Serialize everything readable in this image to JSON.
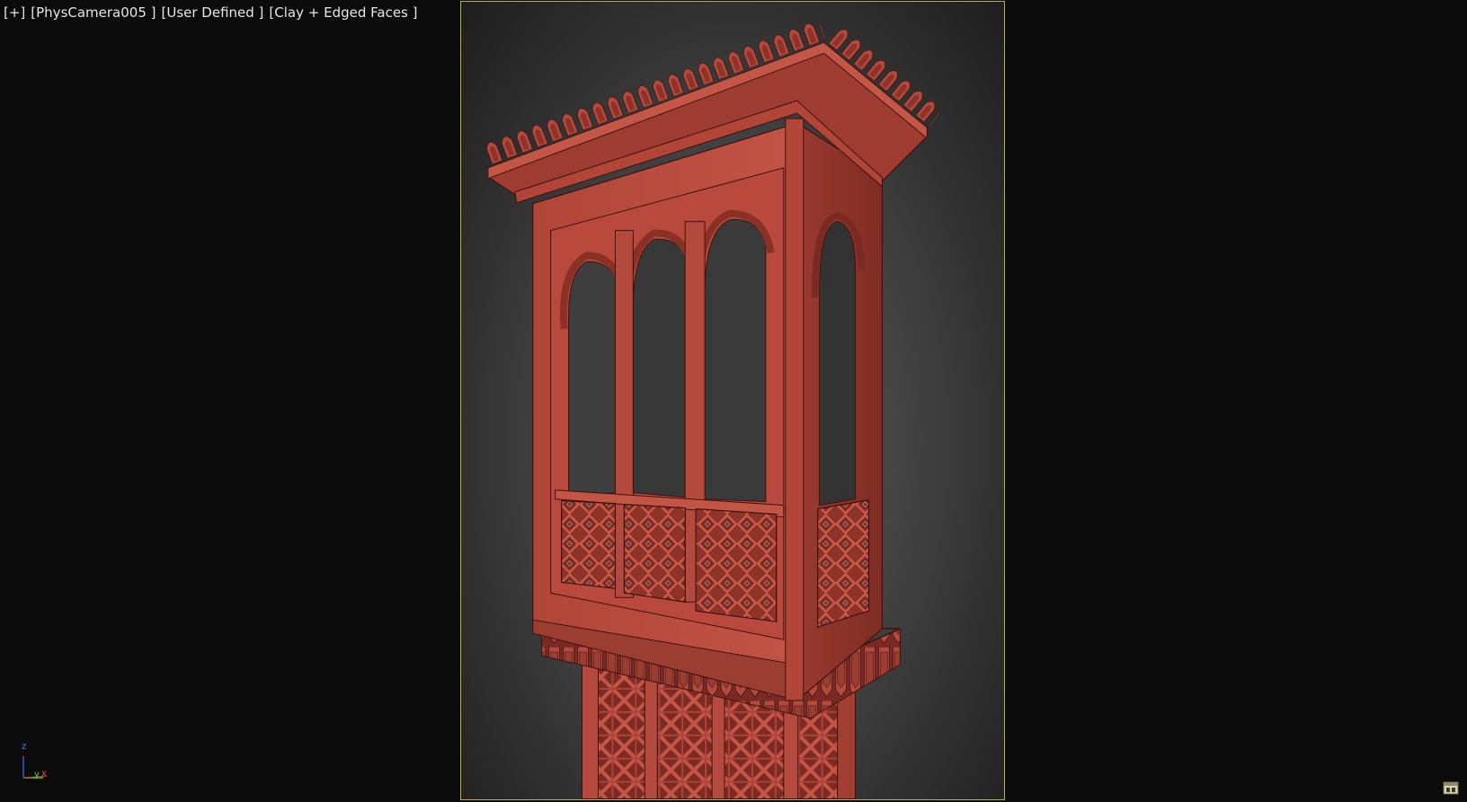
{
  "viewport": {
    "labels": {
      "plus": "[+]",
      "camera": "[PhysCamera005 ]",
      "view_mode": "[User Defined ]",
      "shading": "[Clay + Edged Faces ]"
    },
    "model_name": "",
    "gizmo": {
      "z_label": "z",
      "y_label": "y",
      "x_label": "x"
    },
    "colors": {
      "model": "#b8493c",
      "model_shadow": "#7a2a22",
      "edges": "#3d120e",
      "safe_frame": "#b8b23a",
      "background_center": "#5b5b5b",
      "background_edge": "#1e1e1e"
    },
    "corner_icon": "viewport-layout-icon"
  }
}
